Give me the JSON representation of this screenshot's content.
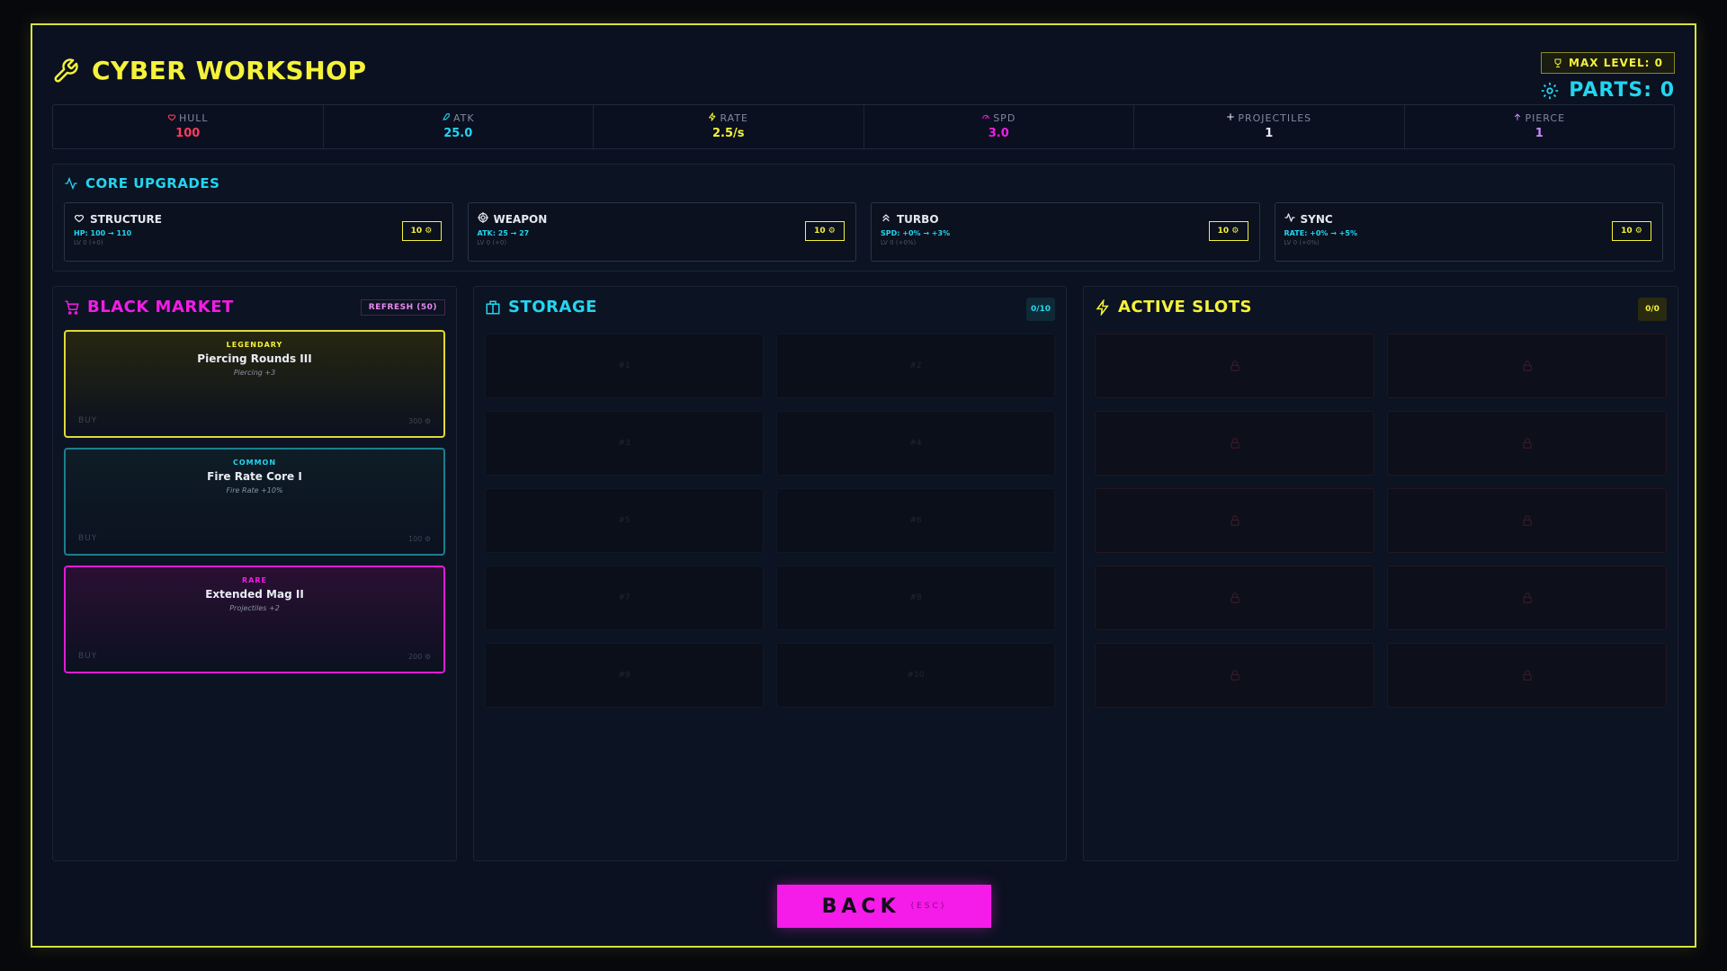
{
  "colors": {
    "yellow": "#f5f23a",
    "cyan": "#23d5f0",
    "magenta": "#f51be8",
    "red": "#ff3b5c",
    "purple": "#c98af7"
  },
  "header": {
    "title": "CYBER WORKSHOP",
    "max_level": "MAX LEVEL: 0",
    "parts": "PARTS: 0"
  },
  "stats": [
    {
      "label": "HULL",
      "value": "100",
      "icon": "heart-icon",
      "color": "#ff3b5c"
    },
    {
      "label": "ATK",
      "value": "25.0",
      "icon": "sword-icon",
      "color": "#23d5f0"
    },
    {
      "label": "RATE",
      "value": "2.5/s",
      "icon": "bolt-icon",
      "color": "#f5f23a"
    },
    {
      "label": "SPD",
      "value": "3.0",
      "icon": "gauge-icon",
      "color": "#f51be8"
    },
    {
      "label": "PROJECTILES",
      "value": "1",
      "icon": "plus-icon",
      "color": "#e8ecf4"
    },
    {
      "label": "PIERCE",
      "value": "1",
      "icon": "arrow-icon",
      "color": "#c98af7"
    }
  ],
  "core": {
    "title": "CORE UPGRADES",
    "cards": [
      {
        "name": "STRUCTURE",
        "detail": "HP: 100 → 110",
        "level": "LV 0 (+0)",
        "cost": "10 ⚙",
        "icon": "heart-icon"
      },
      {
        "name": "WEAPON",
        "detail": "ATK: 25 → 27",
        "level": "LV 0 (+0)",
        "cost": "10 ⚙",
        "icon": "target-icon"
      },
      {
        "name": "TURBO",
        "detail": "SPD: +0% → +3%",
        "level": "LV 0 (+0%)",
        "cost": "10 ⚙",
        "icon": "chevron-up-icon"
      },
      {
        "name": "SYNC",
        "detail": "RATE: +0% → +5%",
        "level": "LV 0 (+0%)",
        "cost": "10 ⚙",
        "icon": "pulse-icon"
      }
    ]
  },
  "market": {
    "title": "BLACK MARKET",
    "refresh": "REFRESH (50)",
    "items": [
      {
        "rarity": "LEGENDARY",
        "name": "Piercing Rounds III",
        "desc": "Piercing +3",
        "buy": "BUY",
        "price": "300 ⚙",
        "border": "#e0d83a",
        "bg": "#26260f",
        "rcolor": "#f5f23a"
      },
      {
        "rarity": "COMMON",
        "name": "Fire Rate Core I",
        "desc": "Fire Rate +10%",
        "buy": "BUY",
        "price": "100 ⚙",
        "border": "#1a7f8f",
        "bg": "#0e1d26",
        "rcolor": "#23d5f0"
      },
      {
        "rarity": "RARE",
        "name": "Extended Mag II",
        "desc": "Projectiles +2",
        "buy": "BUY",
        "price": "200 ⚙",
        "border": "#e01bd6",
        "bg": "#2a0f33",
        "rcolor": "#f51be8"
      }
    ]
  },
  "storage": {
    "title": "STORAGE",
    "count": "0/10",
    "slots": [
      "#1",
      "#2",
      "#3",
      "#4",
      "#5",
      "#6",
      "#7",
      "#8",
      "#9",
      "#10"
    ]
  },
  "active": {
    "title": "ACTIVE SLOTS",
    "count": "0/0"
  },
  "back": {
    "label": "BACK",
    "key": "(ESC)"
  }
}
